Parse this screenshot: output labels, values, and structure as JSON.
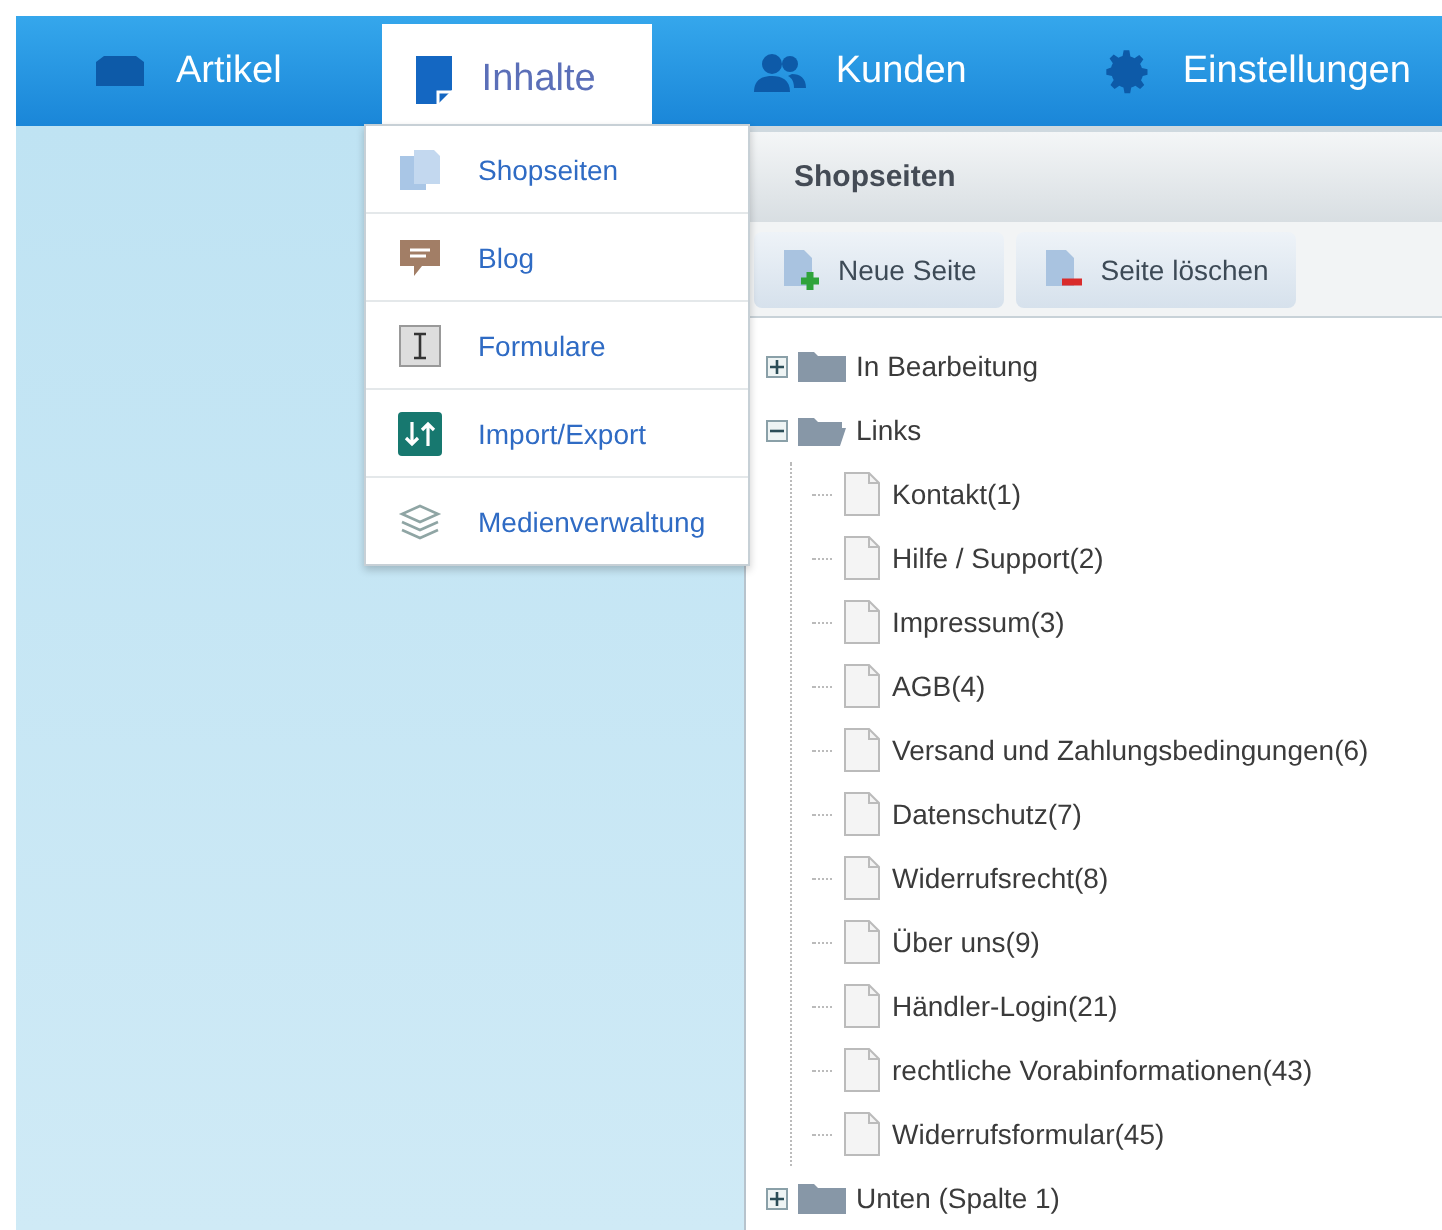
{
  "nav": [
    {
      "label": "Artikel",
      "selected": false
    },
    {
      "label": "Inhalte",
      "selected": true
    },
    {
      "label": "Kunden",
      "selected": false
    },
    {
      "label": "Einstellungen",
      "selected": false
    }
  ],
  "menu": [
    {
      "label": "Shopseiten"
    },
    {
      "label": "Blog"
    },
    {
      "label": "Formulare"
    },
    {
      "label": "Import/Export"
    },
    {
      "label": "Medienverwaltung"
    }
  ],
  "panel": {
    "title": "Shopseiten",
    "buttons": [
      {
        "label": "Neue Seite",
        "kind": "add"
      },
      {
        "label": "Seite löschen",
        "kind": "delete"
      }
    ]
  },
  "tree": [
    {
      "label": "In Bearbeitung",
      "expanded": false
    },
    {
      "label": "Links",
      "expanded": true,
      "children": [
        {
          "label": "Kontakt(1)"
        },
        {
          "label": "Hilfe / Support(2)"
        },
        {
          "label": "Impressum(3)"
        },
        {
          "label": "AGB(4)"
        },
        {
          "label": "Versand und Zahlungsbedingungen(6)"
        },
        {
          "label": "Datenschutz(7)"
        },
        {
          "label": "Widerrufsrecht(8)"
        },
        {
          "label": "Über uns(9)"
        },
        {
          "label": "Händler-Login(21)"
        },
        {
          "label": "rechtliche Vorabinformationen(43)"
        },
        {
          "label": "Widerrufsformular(45)"
        }
      ]
    },
    {
      "label": "Unten (Spalte 1)",
      "expanded": false
    }
  ]
}
